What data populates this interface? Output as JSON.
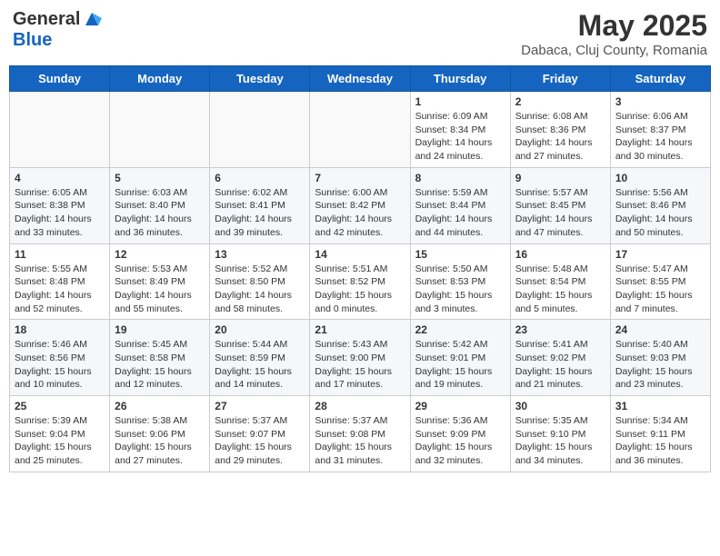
{
  "header": {
    "logo_line1": "General",
    "logo_line2": "Blue",
    "title": "May 2025",
    "subtitle": "Dabaca, Cluj County, Romania"
  },
  "days_of_week": [
    "Sunday",
    "Monday",
    "Tuesday",
    "Wednesday",
    "Thursday",
    "Friday",
    "Saturday"
  ],
  "weeks": [
    [
      {
        "day": "",
        "info": ""
      },
      {
        "day": "",
        "info": ""
      },
      {
        "day": "",
        "info": ""
      },
      {
        "day": "",
        "info": ""
      },
      {
        "day": "1",
        "info": "Sunrise: 6:09 AM\nSunset: 8:34 PM\nDaylight: 14 hours and 24 minutes."
      },
      {
        "day": "2",
        "info": "Sunrise: 6:08 AM\nSunset: 8:36 PM\nDaylight: 14 hours and 27 minutes."
      },
      {
        "day": "3",
        "info": "Sunrise: 6:06 AM\nSunset: 8:37 PM\nDaylight: 14 hours and 30 minutes."
      }
    ],
    [
      {
        "day": "4",
        "info": "Sunrise: 6:05 AM\nSunset: 8:38 PM\nDaylight: 14 hours and 33 minutes."
      },
      {
        "day": "5",
        "info": "Sunrise: 6:03 AM\nSunset: 8:40 PM\nDaylight: 14 hours and 36 minutes."
      },
      {
        "day": "6",
        "info": "Sunrise: 6:02 AM\nSunset: 8:41 PM\nDaylight: 14 hours and 39 minutes."
      },
      {
        "day": "7",
        "info": "Sunrise: 6:00 AM\nSunset: 8:42 PM\nDaylight: 14 hours and 42 minutes."
      },
      {
        "day": "8",
        "info": "Sunrise: 5:59 AM\nSunset: 8:44 PM\nDaylight: 14 hours and 44 minutes."
      },
      {
        "day": "9",
        "info": "Sunrise: 5:57 AM\nSunset: 8:45 PM\nDaylight: 14 hours and 47 minutes."
      },
      {
        "day": "10",
        "info": "Sunrise: 5:56 AM\nSunset: 8:46 PM\nDaylight: 14 hours and 50 minutes."
      }
    ],
    [
      {
        "day": "11",
        "info": "Sunrise: 5:55 AM\nSunset: 8:48 PM\nDaylight: 14 hours and 52 minutes."
      },
      {
        "day": "12",
        "info": "Sunrise: 5:53 AM\nSunset: 8:49 PM\nDaylight: 14 hours and 55 minutes."
      },
      {
        "day": "13",
        "info": "Sunrise: 5:52 AM\nSunset: 8:50 PM\nDaylight: 14 hours and 58 minutes."
      },
      {
        "day": "14",
        "info": "Sunrise: 5:51 AM\nSunset: 8:52 PM\nDaylight: 15 hours and 0 minutes."
      },
      {
        "day": "15",
        "info": "Sunrise: 5:50 AM\nSunset: 8:53 PM\nDaylight: 15 hours and 3 minutes."
      },
      {
        "day": "16",
        "info": "Sunrise: 5:48 AM\nSunset: 8:54 PM\nDaylight: 15 hours and 5 minutes."
      },
      {
        "day": "17",
        "info": "Sunrise: 5:47 AM\nSunset: 8:55 PM\nDaylight: 15 hours and 7 minutes."
      }
    ],
    [
      {
        "day": "18",
        "info": "Sunrise: 5:46 AM\nSunset: 8:56 PM\nDaylight: 15 hours and 10 minutes."
      },
      {
        "day": "19",
        "info": "Sunrise: 5:45 AM\nSunset: 8:58 PM\nDaylight: 15 hours and 12 minutes."
      },
      {
        "day": "20",
        "info": "Sunrise: 5:44 AM\nSunset: 8:59 PM\nDaylight: 15 hours and 14 minutes."
      },
      {
        "day": "21",
        "info": "Sunrise: 5:43 AM\nSunset: 9:00 PM\nDaylight: 15 hours and 17 minutes."
      },
      {
        "day": "22",
        "info": "Sunrise: 5:42 AM\nSunset: 9:01 PM\nDaylight: 15 hours and 19 minutes."
      },
      {
        "day": "23",
        "info": "Sunrise: 5:41 AM\nSunset: 9:02 PM\nDaylight: 15 hours and 21 minutes."
      },
      {
        "day": "24",
        "info": "Sunrise: 5:40 AM\nSunset: 9:03 PM\nDaylight: 15 hours and 23 minutes."
      }
    ],
    [
      {
        "day": "25",
        "info": "Sunrise: 5:39 AM\nSunset: 9:04 PM\nDaylight: 15 hours and 25 minutes."
      },
      {
        "day": "26",
        "info": "Sunrise: 5:38 AM\nSunset: 9:06 PM\nDaylight: 15 hours and 27 minutes."
      },
      {
        "day": "27",
        "info": "Sunrise: 5:37 AM\nSunset: 9:07 PM\nDaylight: 15 hours and 29 minutes."
      },
      {
        "day": "28",
        "info": "Sunrise: 5:37 AM\nSunset: 9:08 PM\nDaylight: 15 hours and 31 minutes."
      },
      {
        "day": "29",
        "info": "Sunrise: 5:36 AM\nSunset: 9:09 PM\nDaylight: 15 hours and 32 minutes."
      },
      {
        "day": "30",
        "info": "Sunrise: 5:35 AM\nSunset: 9:10 PM\nDaylight: 15 hours and 34 minutes."
      },
      {
        "day": "31",
        "info": "Sunrise: 5:34 AM\nSunset: 9:11 PM\nDaylight: 15 hours and 36 minutes."
      }
    ]
  ]
}
